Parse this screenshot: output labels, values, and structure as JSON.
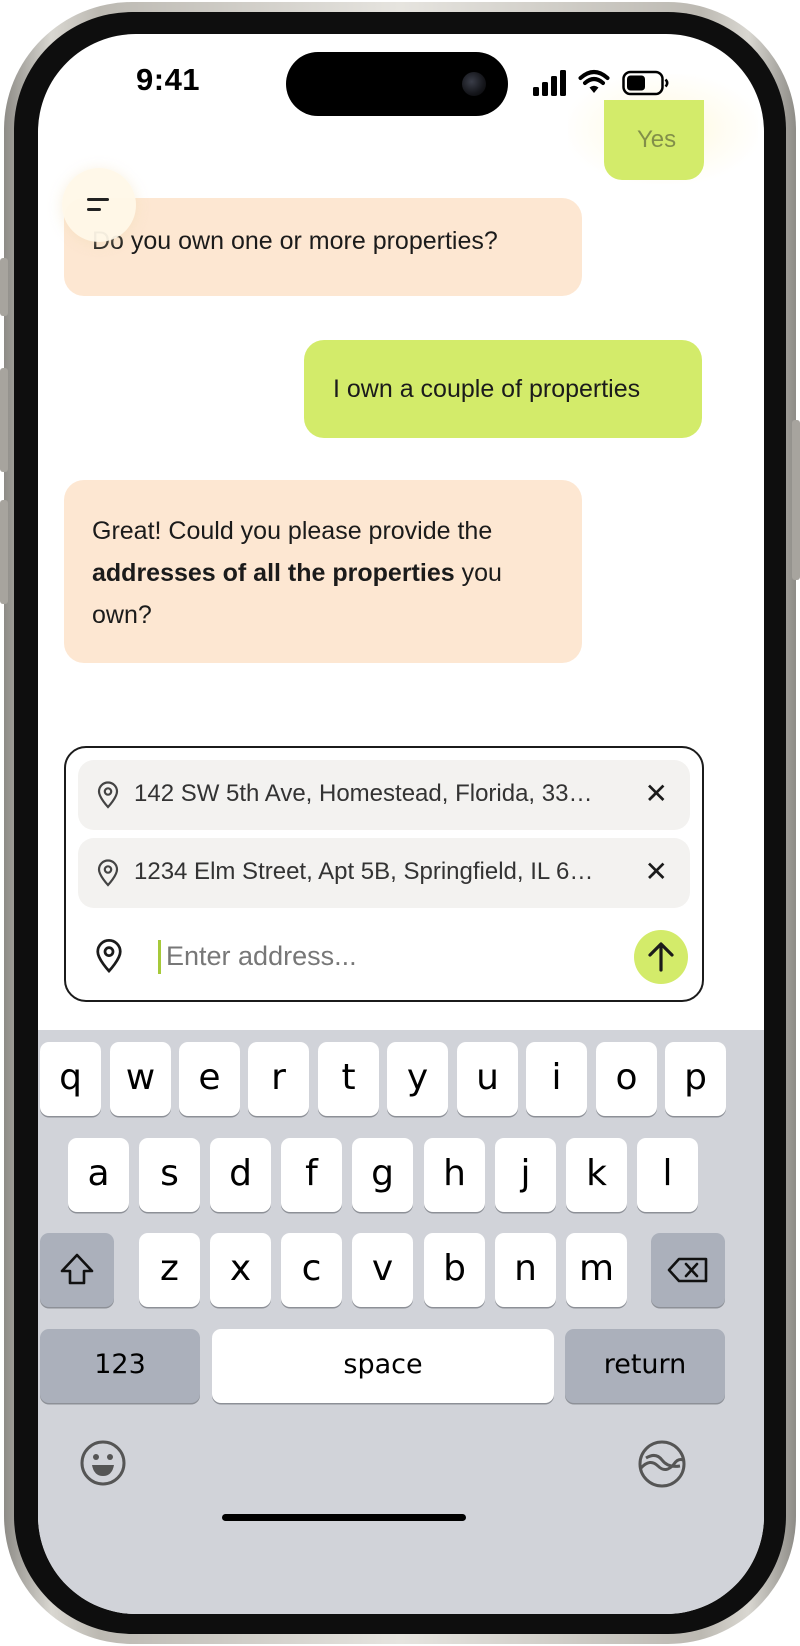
{
  "status_bar": {
    "time": "9:41"
  },
  "chat": {
    "previous_user_reply": "Yes",
    "messages": [
      {
        "role": "bot",
        "text": "Do you own one or more properties?"
      },
      {
        "role": "user",
        "text": "I own a couple of properties"
      },
      {
        "role": "bot",
        "text_parts": [
          "Great! Could you please provide the ",
          "addresses of all the properties",
          " you own?"
        ]
      }
    ]
  },
  "composer": {
    "addresses": [
      "142 SW 5th Ave, Homestead, Florida, 33…",
      "1234 Elm Street, Apt 5B, Springfield, IL 6…"
    ],
    "input_placeholder": "Enter address...",
    "remove_icon": "✕"
  },
  "keyboard": {
    "row1": [
      "q",
      "w",
      "e",
      "r",
      "t",
      "y",
      "u",
      "i",
      "o",
      "p"
    ],
    "row2": [
      "a",
      "s",
      "d",
      "f",
      "g",
      "h",
      "j",
      "k",
      "l"
    ],
    "row3": [
      "z",
      "x",
      "c",
      "v",
      "b",
      "n",
      "m"
    ],
    "numbers_label": "123",
    "space_label": "space",
    "return_label": "return"
  },
  "icons": {
    "menu": "menu-icon",
    "pin": "location-pin-icon",
    "send": "arrow-up-icon",
    "shift": "shift-icon",
    "delete": "backspace-icon",
    "emoji": "emoji-icon",
    "globe": "globe-icon"
  },
  "colors": {
    "user_bubble": "#d3eb6a",
    "bot_bubble": "#fde7d2",
    "keyboard_bg": "#d1d3d9"
  }
}
